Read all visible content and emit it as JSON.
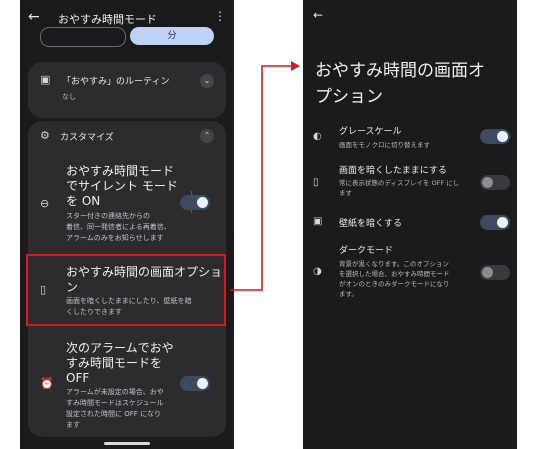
{
  "left_screen": {
    "title": "おやすみ時間モード",
    "back_icon": "arrow-left-icon",
    "menu_icon": "more-vert-icon",
    "chip_selected_label": "分",
    "routine": {
      "title": "「おやすみ」のルーティン",
      "subtitle": "なし"
    },
    "customize": {
      "header": "カスタマイズ",
      "items": [
        {
          "title_lines": [
            "おやすみ時間モード",
            "でサイレント モード",
            "を ON"
          ],
          "desc_lines": [
            "スター付きの連絡先からの",
            "着信、同一発信者による再着信、",
            "アラームのみをお知らせします"
          ],
          "toggle": "on"
        },
        {
          "title_lines": [
            "おやすみ時間の画面オプショ",
            "ン"
          ],
          "desc_lines": [
            "画面を暗くしたままにしたり、壁紙を暗",
            "くしたりできます"
          ]
        },
        {
          "title_lines": [
            "次のアラームでおや",
            "すみ時間モードを",
            "OFF"
          ],
          "desc_lines": [
            "アラームが未設定の場合、おや",
            "すみ時間モードはスケジュール",
            "設定された時間に OFF になり",
            "ます"
          ],
          "toggle": "on"
        }
      ]
    }
  },
  "right_screen": {
    "title_lines": [
      "おやすみ時間の画面オ",
      "プション"
    ],
    "options": [
      {
        "label": "グレースケール",
        "desc_lines": [
          "画面をモノクロに切り替えます"
        ],
        "toggle": "on"
      },
      {
        "label": "画面を暗くしたままにする",
        "desc_lines": [
          "常に表示状態のディスプレイを OFF にし",
          "ます"
        ],
        "toggle": "off"
      },
      {
        "label": "壁紙を暗くする",
        "desc_lines": [],
        "toggle": "on"
      },
      {
        "label": "ダークモード",
        "desc_lines": [
          "背景が黒くなります。このオプション",
          "を選択した場合、おやすみ時間モード",
          "がオンのときのみダークモードになり",
          "ます。"
        ],
        "toggle": "off"
      }
    ]
  },
  "colors": {
    "highlight": "#d71920",
    "screen_bg": "#1b1b1d",
    "card_bg": "#2c2c2f",
    "toggle_on": "#3d4a60"
  }
}
